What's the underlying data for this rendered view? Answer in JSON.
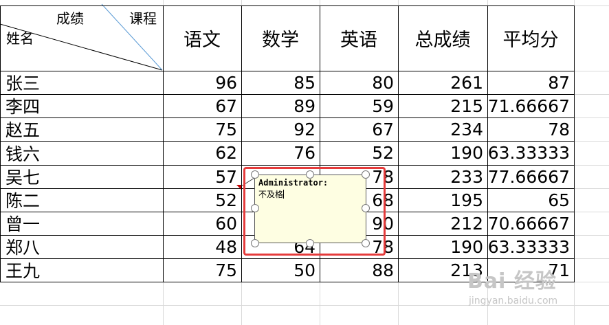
{
  "header": {
    "diag_top_left": "成绩",
    "diag_top_right": "课程",
    "diag_bottom": "姓名",
    "columns": [
      "语文",
      "数学",
      "英语",
      "总成绩",
      "平均分"
    ]
  },
  "rows": [
    {
      "name": "张三",
      "values": [
        "96",
        "85",
        "80",
        "261",
        "87"
      ]
    },
    {
      "name": "李四",
      "values": [
        "67",
        "89",
        "59",
        "215",
        "71.66667"
      ]
    },
    {
      "name": "赵五",
      "values": [
        "75",
        "92",
        "67",
        "234",
        "78"
      ]
    },
    {
      "name": "钱六",
      "values": [
        "62",
        "76",
        "52",
        "190",
        "63.33333"
      ]
    },
    {
      "name": "吴七",
      "values": [
        "57",
        "",
        "78",
        "233",
        "77.66667"
      ]
    },
    {
      "name": "陈二",
      "values": [
        "52",
        "",
        "68",
        "195",
        "65"
      ]
    },
    {
      "name": "曾一",
      "values": [
        "60",
        "",
        "90",
        "212",
        "70.66667"
      ]
    },
    {
      "name": "郑八",
      "values": [
        "48",
        "64",
        "78",
        "190",
        "63.33333"
      ]
    },
    {
      "name": "王九",
      "values": [
        "75",
        "50",
        "88",
        "213",
        "71"
      ]
    }
  ],
  "comment": {
    "author": "Administrator:",
    "text": "不及格"
  },
  "watermark": {
    "logo": "Bai 经验",
    "url": "jingyan.baidu.com"
  },
  "colors": {
    "highlight": "#e53b3b",
    "comment_bg": "#fefee2",
    "gridline": "#d9d9d9"
  }
}
